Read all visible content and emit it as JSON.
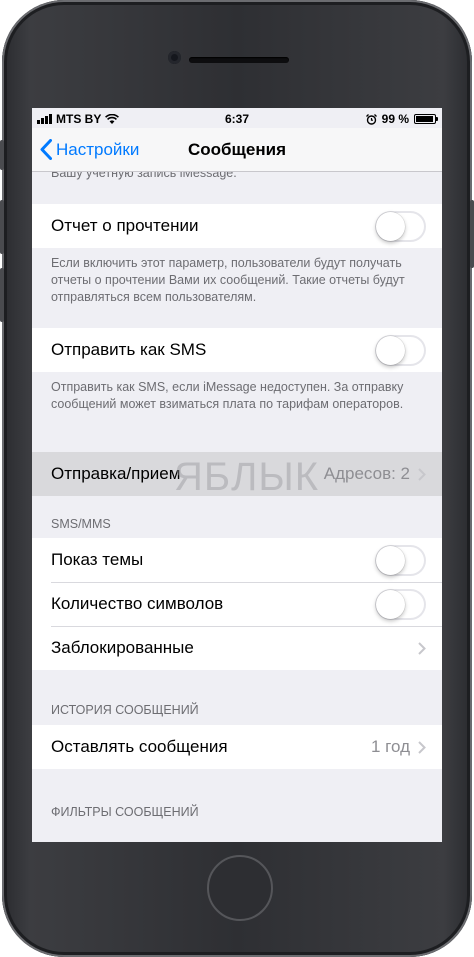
{
  "status": {
    "carrier": "MTS BY",
    "time": "6:37",
    "battery": "99 %"
  },
  "nav": {
    "back_label": "Настройки",
    "title": "Сообщения"
  },
  "top_clipped_text": "Вашу учетную запись iMessage.",
  "read_receipts": {
    "label": "Отчет о прочтении",
    "on": false,
    "footer": "Если включить этот параметр, пользователи будут получать отчеты о прочтении Вами их сообщений. Такие отчеты будут отправляться всем пользователям."
  },
  "send_as_sms": {
    "label": "Отправить как SMS",
    "on": false,
    "footer": "Отправить как SMS, если iMessage недоступен. За отправку сообщений может взиматься плата по тарифам операторов."
  },
  "send_receive": {
    "label": "Отправка/прием",
    "value": "Адресов: 2"
  },
  "sms_mms": {
    "header": "SMS/MMS",
    "show_subject": {
      "label": "Показ темы",
      "on": false
    },
    "char_count": {
      "label": "Количество символов",
      "on": false
    },
    "blocked": {
      "label": "Заблокированные"
    }
  },
  "history": {
    "header": "ИСТОРИЯ СООБЩЕНИЙ",
    "keep_messages": {
      "label": "Оставлять сообщения",
      "value": "1 год"
    }
  },
  "filters": {
    "header": "ФИЛЬТРЫ СООБЩЕНИЙ"
  },
  "watermark": "ЯБЛЫК",
  "colors": {
    "accent": "#007aff",
    "background": "#efeff4",
    "secondary_text": "#8e8e93"
  }
}
